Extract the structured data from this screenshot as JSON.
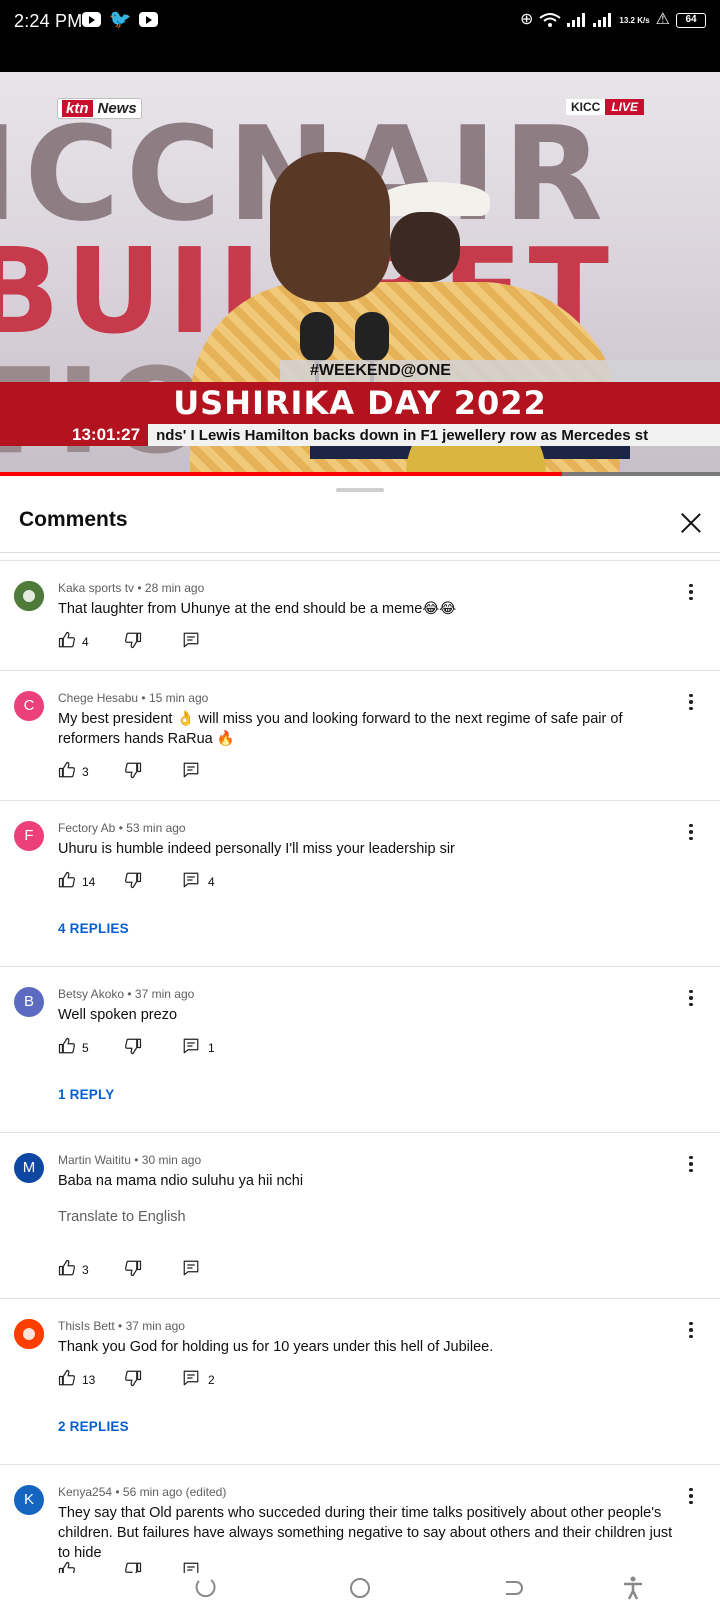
{
  "status_bar": {
    "time": "2:24 PM",
    "app_icons": [
      "youtube-icon",
      "twitter-icon",
      "youtube-icon"
    ],
    "net_speed": "13.2 K/s",
    "battery": "64"
  },
  "video": {
    "channel_logo_left": "ktn",
    "channel_logo_right": "News",
    "venue": "KICC",
    "live_label": "LIVE",
    "hashtag": "#WEEKEND@ONE",
    "banner": "USHIRIKA DAY 2022",
    "clock": "13:01:27",
    "ticker": "nds'  I  Lewis Hamilton backs down in F1 jewellery row as Mercedes st",
    "background_text": [
      "ICCNAIR",
      "BUIL  BET",
      "TIO     TH"
    ],
    "progress_fraction": 0.78
  },
  "sheet": {
    "title": "Comments"
  },
  "comments": [
    {
      "author": "Kaka sports tv",
      "meta": "28 min ago",
      "text": "That laughter from Uhunye at the end should be a meme😂😂",
      "likes": "4",
      "replies_count": "",
      "replies_link": "",
      "translate": "",
      "avatar_letter": "",
      "avatar_color": "#4f7b3a"
    },
    {
      "author": "Chege Hesabu",
      "meta": "15 min ago",
      "text": "My best president 👌 will miss you and looking forward to the next regime of safe pair of reformers hands RaRua 🔥",
      "likes": "3",
      "replies_count": "",
      "replies_link": "",
      "translate": "",
      "avatar_letter": "C",
      "avatar_color": "#ec407a"
    },
    {
      "author": "Fectory Ab",
      "meta": "53 min ago",
      "text": "Uhuru is humble indeed personally I'll miss your leadership sir",
      "likes": "14",
      "replies_count": "4",
      "replies_link": "4 REPLIES",
      "translate": "",
      "avatar_letter": "F",
      "avatar_color": "#ec407a"
    },
    {
      "author": "Betsy Akoko",
      "meta": "37 min ago",
      "text": "Well spoken prezo",
      "likes": "5",
      "replies_count": "1",
      "replies_link": "1 REPLY",
      "translate": "",
      "avatar_letter": "B",
      "avatar_color": "#5c6bc0"
    },
    {
      "author": "Martin Waititu",
      "meta": "30 min ago",
      "text": "Baba na mama ndio suluhu ya hii nchi",
      "likes": "3",
      "replies_count": "",
      "replies_link": "",
      "translate": "Translate to English",
      "avatar_letter": "M",
      "avatar_color": "#0d47a1"
    },
    {
      "author": "ThisIs Bett",
      "meta": "37 min ago",
      "text": "Thank you God for holding us for 10 years under this hell of Jubilee.",
      "likes": "13",
      "replies_count": "2",
      "replies_link": "2 REPLIES",
      "translate": "",
      "avatar_letter": "",
      "avatar_color": "#ff3d00"
    },
    {
      "author": "Kenya254",
      "meta": "56 min ago (edited)",
      "text": "They say that Old parents who succeded during their time talks positively about other people's children. But failures have always something negative to say about others and their children just to hide",
      "likes": "",
      "replies_count": "",
      "replies_link": "",
      "translate": "",
      "avatar_letter": "K",
      "avatar_color": "#1565c0"
    }
  ],
  "colors": {
    "accent_link": "#065fd4",
    "progress": "#ff0000",
    "banner": "#b3121f"
  },
  "navbar": {
    "buttons": [
      "recent-apps-icon",
      "home-icon",
      "back-icon",
      "accessibility-icon"
    ]
  }
}
